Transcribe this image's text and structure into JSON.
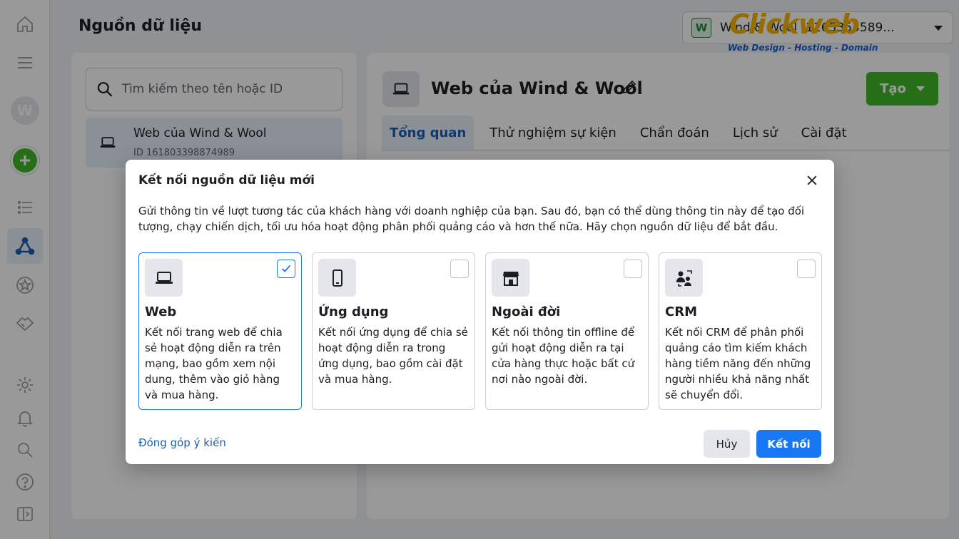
{
  "page": {
    "title": "Nguồn dữ liệu"
  },
  "account": {
    "badge": "W",
    "name": "Wind & Wool (1165353589..."
  },
  "watermark": {
    "brand": "Clickweb",
    "tagline": "Web Design - Hosting - Domain"
  },
  "rail": {
    "avatar": "W",
    "items": [
      "home-icon",
      "menu-icon",
      "add-icon",
      "list-icon",
      "data-sources-icon",
      "star-icon",
      "partners-icon",
      "settings-icon",
      "bell-icon",
      "search-icon",
      "help-icon",
      "panel-icon"
    ]
  },
  "left_panel": {
    "search_placeholder": "Tìm kiếm theo tên hoặc ID",
    "source": {
      "name": "Web của Wind & Wool",
      "id": "ID 161803398874989"
    }
  },
  "right_panel": {
    "title": "Web của Wind & Wool",
    "create_label": "Tạo",
    "tabs": [
      "Tổng quan",
      "Thử nghiệm sự kiện",
      "Chẩn đoán",
      "Lịch sử",
      "Cài đặt"
    ]
  },
  "modal": {
    "title": "Kết nối nguồn dữ liệu mới",
    "description": "Gửi thông tin về lượt tương tác của khách hàng với doanh nghiệp của bạn. Sau đó, bạn có thể dùng thông tin này để tạo đối tượng, chạy chiến dịch, tối ưu hóa hoạt động phân phối quảng cáo và hơn thế nữa. Hãy chọn nguồn dữ liệu để bắt đầu.",
    "cards": [
      {
        "title": "Web",
        "icon": "laptop-icon",
        "selected": true,
        "desc": "Kết nối trang web để chia sẻ hoạt động diễn ra trên mạng, bao gồm xem nội dung, thêm vào giỏ hàng và mua hàng."
      },
      {
        "title": "Ứng dụng",
        "icon": "phone-icon",
        "selected": false,
        "desc": "Kết nối ứng dụng để chia sẻ hoạt động diễn ra trong ứng dụng, bao gồm cài đặt và mua hàng."
      },
      {
        "title": "Ngoài đời",
        "icon": "store-icon",
        "selected": false,
        "desc": "Kết nối thông tin offline để gửi hoạt động diễn ra tại cửa hàng thực hoặc bất cứ nơi nào ngoài đời."
      },
      {
        "title": "CRM",
        "icon": "crm-icon",
        "selected": false,
        "desc": "Kết nối CRM để phân phối quảng cáo tìm kiếm khách hàng tiềm năng đến những người nhiều khả năng nhất sẽ chuyển đổi."
      }
    ],
    "feedback_label": "Đóng góp ý kiến",
    "cancel_label": "Hủy",
    "connect_label": "Kết nối"
  },
  "colors": {
    "accent": "#1877f2",
    "create_green": "#42b72a",
    "link": "#1a5fb4"
  }
}
